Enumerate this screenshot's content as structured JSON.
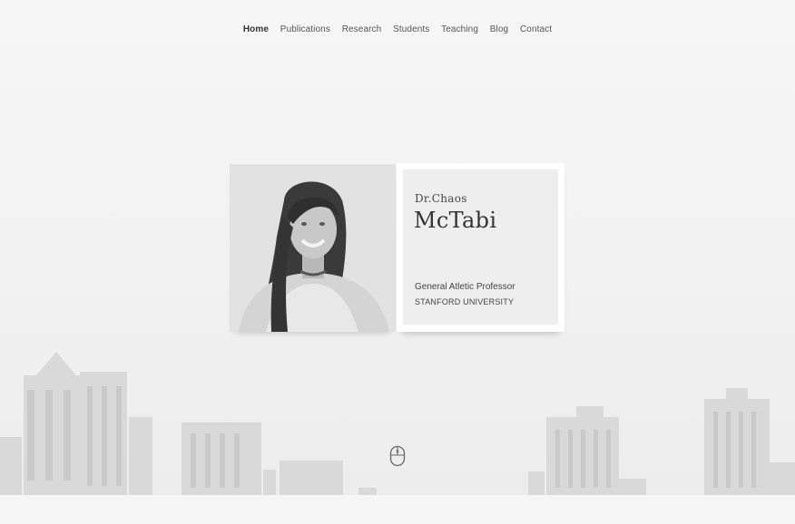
{
  "nav": {
    "items": [
      {
        "label": "Home",
        "active": true
      },
      {
        "label": "Publications",
        "active": false
      },
      {
        "label": "Research",
        "active": false
      },
      {
        "label": "Students",
        "active": false
      },
      {
        "label": "Teaching",
        "active": false
      },
      {
        "label": "Blog",
        "active": false
      },
      {
        "label": "Contact",
        "active": false
      }
    ]
  },
  "profile": {
    "prefix": "Dr.Chaos",
    "surname": "McTabi",
    "position": "General Atletic Professor",
    "university": "STANFORD UNIVERSITY"
  },
  "icons": {
    "scroll": "mouse-scroll-icon",
    "photo": "profile-photo"
  },
  "colors": {
    "background": "#f4f4f4",
    "text": "#444444",
    "card": "#ffffff",
    "card_inner": "#eeeeee"
  }
}
